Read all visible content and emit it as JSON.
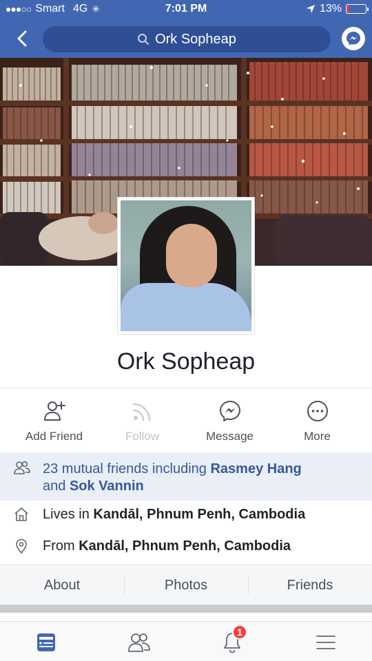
{
  "status_bar": {
    "carrier": "Smart",
    "network": "4G",
    "time": "7:01 PM",
    "battery": "13%",
    "battery_level": 0.13
  },
  "header": {
    "search_text": "Ork Sopheap",
    "icons": {
      "back": "chevron-left-icon",
      "search": "search-icon",
      "messenger": "messenger-icon"
    }
  },
  "profile": {
    "name": "Ork Sopheap"
  },
  "actions": [
    {
      "label": "Add Friend",
      "icon": "add-friend-icon",
      "enabled": true
    },
    {
      "label": "Follow",
      "icon": "follow-icon",
      "enabled": false
    },
    {
      "label": "Message",
      "icon": "messenger-icon",
      "enabled": true
    },
    {
      "label": "More",
      "icon": "more-icon",
      "enabled": true
    }
  ],
  "mutual_friends": {
    "prefix": "23 mutual friends including ",
    "friend1": "Rasmey Hang",
    "joiner": "and ",
    "friend2": "Sok Vannin"
  },
  "info": {
    "lives_prefix": "Lives in ",
    "lives_place": "Kandāl, Phnum Penh, Cambodia",
    "from_prefix": "From ",
    "from_place": "Kandāl, Phnum Penh, Cambodia"
  },
  "tabs": [
    "About",
    "Photos",
    "Friends"
  ],
  "bottom_nav": {
    "icons": [
      "news-feed-icon",
      "friends-icon",
      "notifications-icon",
      "menu-icon"
    ],
    "notification_count": "1"
  },
  "colors": {
    "brand_blue": "#4267b2",
    "link_blue": "#365899",
    "badge_red": "#fa3e3e"
  }
}
